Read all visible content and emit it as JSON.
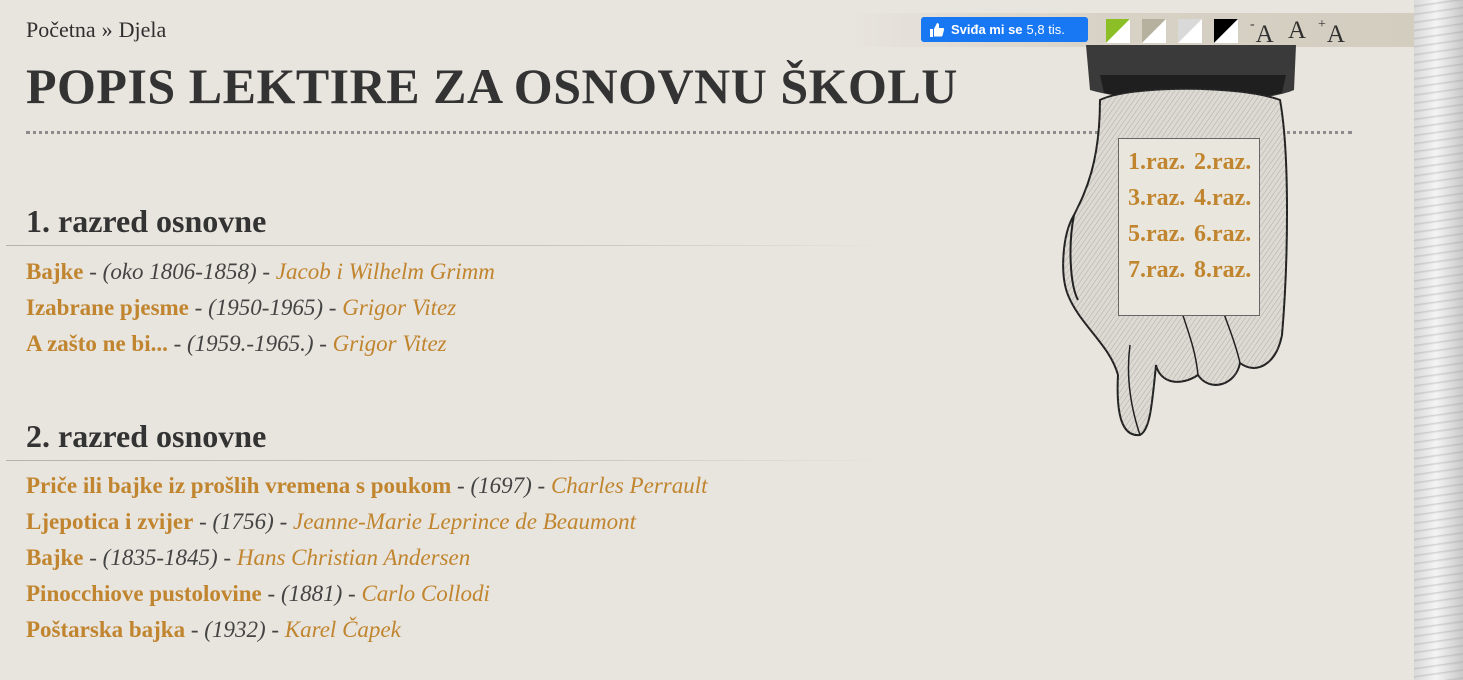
{
  "breadcrumb": {
    "home": "Početna",
    "separator": "»",
    "current": "Djela"
  },
  "facebook": {
    "label": "Sviđa mi se",
    "count": "5,8 tis."
  },
  "contrast_swatches": [
    {
      "name": "green",
      "color": "#8cbf26"
    },
    {
      "name": "beige",
      "color": "#b6b09f"
    },
    {
      "name": "light",
      "color": "#d9d9d9"
    },
    {
      "name": "black",
      "color": "#000000"
    }
  ],
  "font_controls": [
    {
      "prefix": "-",
      "label": "A"
    },
    {
      "prefix": "",
      "label": "A"
    },
    {
      "prefix": "+",
      "label": "A"
    }
  ],
  "page_title": "POPIS LEKTIRE ZA OSNOVNU ŠKOLU",
  "class_links": [
    "1.raz.",
    "2.raz.",
    "3.raz.",
    "4.raz.",
    "5.raz.",
    "6.raz.",
    "7.raz.",
    "8.raz."
  ],
  "sections": [
    {
      "title": "1. razred osnovne",
      "books": [
        {
          "title": "Bajke",
          "years": "(oko 1806-1858)",
          "author": "Jacob i Wilhelm Grimm"
        },
        {
          "title": "Izabrane pjesme",
          "years": "(1950-1965)",
          "author": "Grigor Vitez"
        },
        {
          "title": "A zašto ne bi...",
          "years": "(1959.-1965.)",
          "author": "Grigor Vitez"
        }
      ]
    },
    {
      "title": "2. razred osnovne",
      "books": [
        {
          "title": "Priče ili bajke iz prošlih vremena s poukom",
          "years": "(1697)",
          "author": "Charles Perrault"
        },
        {
          "title": "Ljepotica i zvijer",
          "years": "(1756)",
          "author": "Jeanne-Marie Leprince de Beaumont"
        },
        {
          "title": "Bajke",
          "years": "(1835-1845)",
          "author": "Hans Christian Andersen"
        },
        {
          "title": "Pinocchiove pustolovine",
          "years": "(1881)",
          "author": "Carlo Collodi"
        },
        {
          "title": "Poštarska bajka",
          "years": "(1932)",
          "author": "Karel Čapek"
        }
      ]
    }
  ],
  "colors": {
    "link": "#c0852e",
    "text": "#2f2f2f",
    "background": "#e8e4de",
    "facebook": "#1877f2"
  },
  "dash": "-"
}
